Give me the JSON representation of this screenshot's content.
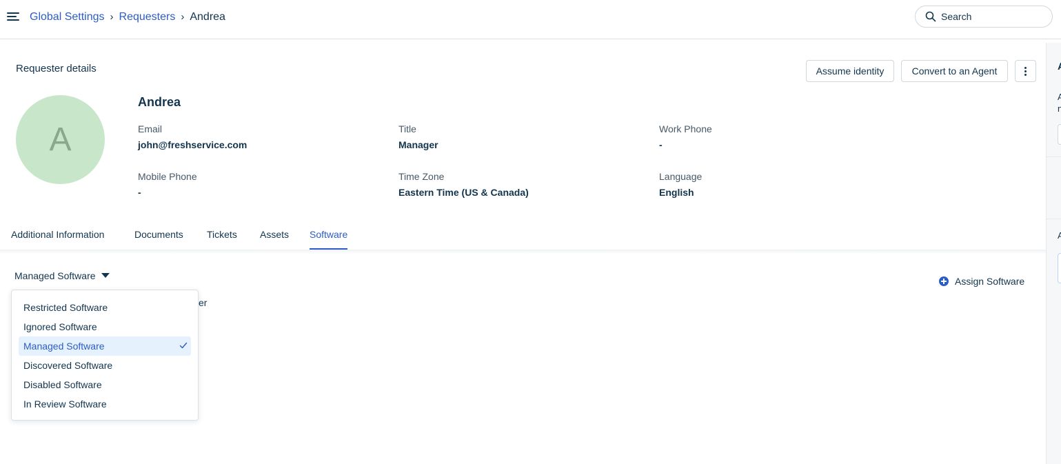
{
  "breadcrumb": {
    "items": [
      "Global Settings",
      "Requesters"
    ],
    "current": "Andrea"
  },
  "search": {
    "placeholder": "Search"
  },
  "header": {
    "section_title": "Requester details",
    "assume_label": "Assume identity",
    "convert_label": "Convert to an Agent"
  },
  "requester": {
    "avatar_initial": "A",
    "name": "Andrea",
    "fields": [
      {
        "label": "Email",
        "value": "john@freshservice.com"
      },
      {
        "label": "Title",
        "value": "Manager"
      },
      {
        "label": "Work Phone",
        "value": "-"
      },
      {
        "label": "Mobile Phone",
        "value": "-"
      },
      {
        "label": "Time Zone",
        "value": "Eastern Time (US & Canada)"
      },
      {
        "label": "Language",
        "value": "English"
      }
    ]
  },
  "tabs": [
    {
      "label": "Additional Information"
    },
    {
      "label": "Documents"
    },
    {
      "label": "Tickets"
    },
    {
      "label": "Assets"
    },
    {
      "label": "Software",
      "active": true
    }
  ],
  "software": {
    "dropdown_label": "Managed Software",
    "partial_text": "er",
    "assign_label": "Assign Software",
    "menu_items": [
      {
        "label": "Restricted Software"
      },
      {
        "label": "Ignored Software"
      },
      {
        "label": "Managed Software",
        "selected": true
      },
      {
        "label": "Discovered Software"
      },
      {
        "label": "Disabled Software"
      },
      {
        "label": "In Review Software"
      }
    ]
  },
  "colors": {
    "accent": "#2c5cc5",
    "text": "#12344d",
    "avatar_bg": "#c8e6c9",
    "selected_bg": "#e5f2fd"
  }
}
